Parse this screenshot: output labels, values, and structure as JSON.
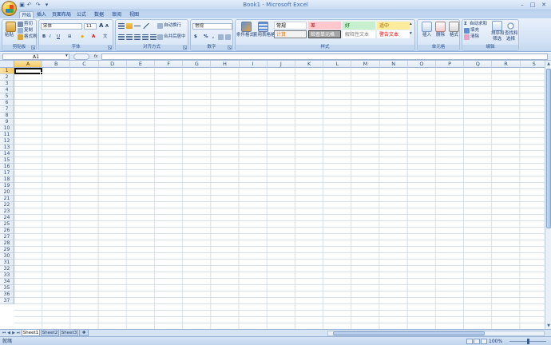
{
  "window": {
    "title": "Book1 - Microsoft Excel"
  },
  "quick_access": [
    {
      "icon": "save-icon",
      "glyph": "▣"
    },
    {
      "icon": "undo-icon",
      "glyph": "↶"
    },
    {
      "icon": "redo-icon",
      "glyph": "↷"
    },
    {
      "icon": "customize-icon",
      "glyph": "▾"
    }
  ],
  "window_controls": {
    "minimize": "–",
    "maximize": "□",
    "close": "✕"
  },
  "tabs": [
    "开始",
    "插入",
    "页面布局",
    "公式",
    "数据",
    "审阅",
    "视图"
  ],
  "ribbon": {
    "clipboard": {
      "label": "剪贴板",
      "paste": "粘贴",
      "cut": "剪切",
      "copy": "复制",
      "format_painter": "格式刷"
    },
    "font": {
      "label": "字体",
      "font_name": "宋体",
      "font_size": "11",
      "grow": "A",
      "shrink": "A",
      "bold": "B",
      "italic": "I",
      "underline": "U",
      "border": "⊞",
      "fill": "◆",
      "font_color": "A",
      "phonetic": "文"
    },
    "alignment": {
      "label": "对齐方式",
      "wrap": "自动换行",
      "merge": "合并后居中"
    },
    "number": {
      "label": "数字",
      "format": "常规",
      "currency": "$",
      "percent": "%",
      "comma": ","
    },
    "styles": {
      "label": "样式",
      "conditional": "条件格式",
      "table": "套用表格格式",
      "cells": [
        {
          "text": "常规",
          "bg": "#ffffff",
          "color": "#000000",
          "border": "#c9d3e0"
        },
        {
          "text": "差",
          "bg": "#ffc7ce",
          "color": "#9c0006",
          "border": "#ffc7ce"
        },
        {
          "text": "好",
          "bg": "#c6efce",
          "color": "#006100",
          "border": "#c6efce"
        },
        {
          "text": "适中",
          "bg": "#ffeb9c",
          "color": "#9c6500",
          "border": "#ffeb9c"
        },
        {
          "text": "计算",
          "bg": "#f2f2f2",
          "color": "#fa7d00",
          "border": "#7f7f7f"
        },
        {
          "text": "检查单元格",
          "bg": "#a5a5a5",
          "color": "#ffffff",
          "border": "#3f3f3f"
        },
        {
          "text": "解释性文本",
          "bg": "#ffffff",
          "color": "#7f7f7f",
          "border": "#ffffff"
        },
        {
          "text": "警告文本",
          "bg": "#ffffff",
          "color": "#ff0000",
          "border": "#ffffff"
        }
      ]
    },
    "cells": {
      "label": "单元格",
      "insert": "插入",
      "delete": "删除",
      "format": "格式"
    },
    "editing": {
      "label": "编辑",
      "autosum": "自动求和",
      "fill": "填充",
      "clear": "清除",
      "sort": "排序和",
      "sort2": "筛选",
      "find": "查找和",
      "find2": "选择"
    }
  },
  "formula_bar": {
    "name_box": "A1",
    "fx": "fx",
    "formula": ""
  },
  "columns": [
    "A",
    "B",
    "C",
    "D",
    "E",
    "F",
    "G",
    "H",
    "I",
    "J",
    "K",
    "L",
    "M",
    "N",
    "O",
    "P",
    "Q",
    "R",
    "S"
  ],
  "rows": [
    "1",
    "2",
    "3",
    "4",
    "5",
    "6",
    "7",
    "8",
    "9",
    "10",
    "11",
    "12",
    "13",
    "14",
    "15",
    "16",
    "17",
    "18",
    "19",
    "20",
    "21",
    "22",
    "23",
    "24",
    "25",
    "26",
    "27",
    "28",
    "29",
    "30",
    "31",
    "32",
    "33",
    "34",
    "35",
    "36",
    "37"
  ],
  "selected_cell": "A1",
  "sheets": [
    {
      "name": "Sheet1",
      "active": true
    },
    {
      "name": "Sheet2",
      "active": false
    },
    {
      "name": "Sheet3",
      "active": false
    }
  ],
  "status": {
    "ready": "就绪",
    "zoom": "100%"
  }
}
